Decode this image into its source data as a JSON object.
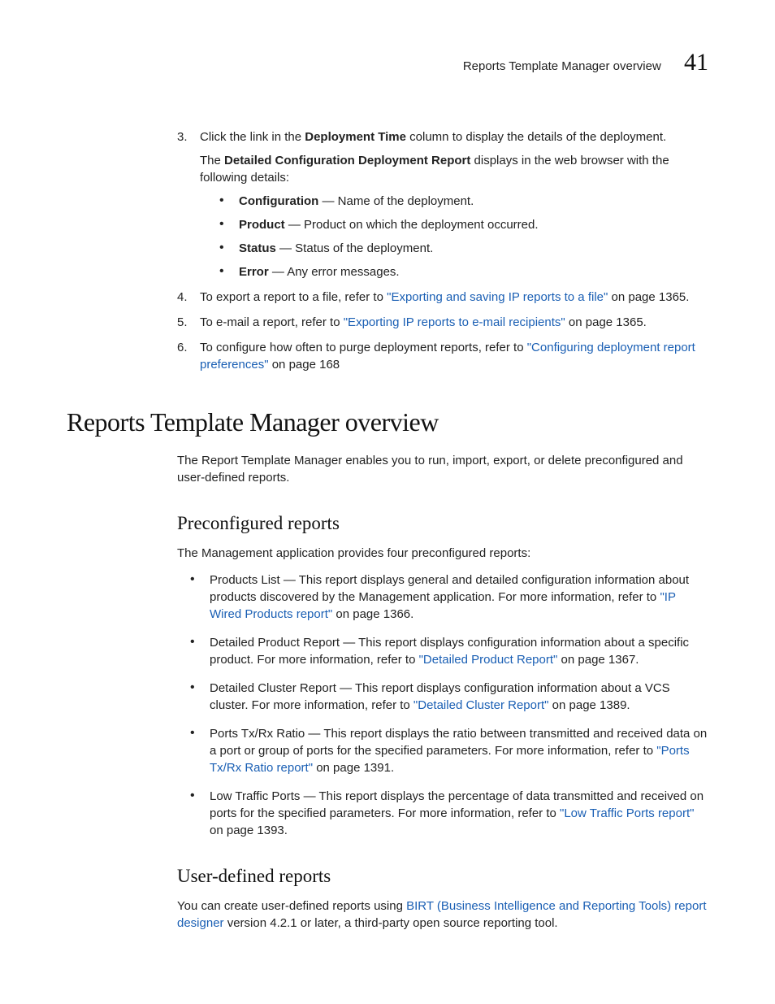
{
  "header": {
    "running_title": "Reports Template Manager overview",
    "chapter_number": "41"
  },
  "steps": {
    "s3": {
      "num": "3.",
      "text_pre": "Click the link in the ",
      "bold1": "Deployment Time",
      "text_post": " column to display the details of the deployment.",
      "intro_pre": "The ",
      "intro_bold": "Detailed Configuration Deployment Report",
      "intro_post": " displays in the web browser with the following details:",
      "bullets": [
        {
          "term": "Configuration",
          "desc": " — Name of the deployment."
        },
        {
          "term": "Product",
          "desc": " — Product on which the deployment occurred."
        },
        {
          "term": "Status",
          "desc": " — Status of the deployment."
        },
        {
          "term": "Error",
          "desc": " — Any error messages."
        }
      ]
    },
    "s4": {
      "num": "4.",
      "pre": "To export a report to a file, refer to ",
      "link": "\"Exporting and saving IP reports to a file\"",
      "post": " on page 1365."
    },
    "s5": {
      "num": "5.",
      "pre": "To e-mail a report, refer to ",
      "link": "\"Exporting IP reports to e-mail recipients\"",
      "post": " on page 1365."
    },
    "s6": {
      "num": "6.",
      "pre": "To configure how often to purge deployment reports, refer to ",
      "link": "\"Configuring deployment report preferences\"",
      "post": " on page 168"
    }
  },
  "section": {
    "heading": "Reports Template Manager overview",
    "intro": "The Report Template Manager enables you to run, import, export, or delete preconfigured and user-defined reports."
  },
  "preconf": {
    "heading": "Preconfigured reports",
    "intro": "The Management application provides four preconfigured reports:",
    "items": [
      {
        "pre": "Products List — This report displays general and detailed configuration information about products discovered by the Management application. For more information, refer to ",
        "link": "\"IP Wired Products report\"",
        "post": " on page 1366."
      },
      {
        "pre": "Detailed Product Report — This report displays configuration information about a specific product. For more information, refer to ",
        "link": "\"Detailed Product Report\"",
        "post": " on page 1367."
      },
      {
        "pre": "Detailed Cluster Report — This report displays configuration information about a VCS cluster. For more information, refer to ",
        "link": "\"Detailed Cluster Report\"",
        "post": " on page 1389."
      },
      {
        "pre": "Ports Tx/Rx Ratio — This report displays the ratio between transmitted and received data on a port or group of ports for the specified parameters. For more information, refer to ",
        "link": "\"Ports Tx/Rx Ratio report\"",
        "post": " on page 1391."
      },
      {
        "pre": "Low Traffic Ports — This report displays the percentage of data transmitted and received on ports for the specified parameters. For more information, refer to ",
        "link": "\"Low Traffic Ports report\"",
        "post": " on page 1393."
      }
    ]
  },
  "userdef": {
    "heading": "User-defined reports",
    "pre": "You can create user-defined reports using ",
    "link": "BIRT (Business Intelligence and Reporting Tools) report designer",
    "post": " version 4.2.1 or later, a third-party open source reporting tool."
  }
}
